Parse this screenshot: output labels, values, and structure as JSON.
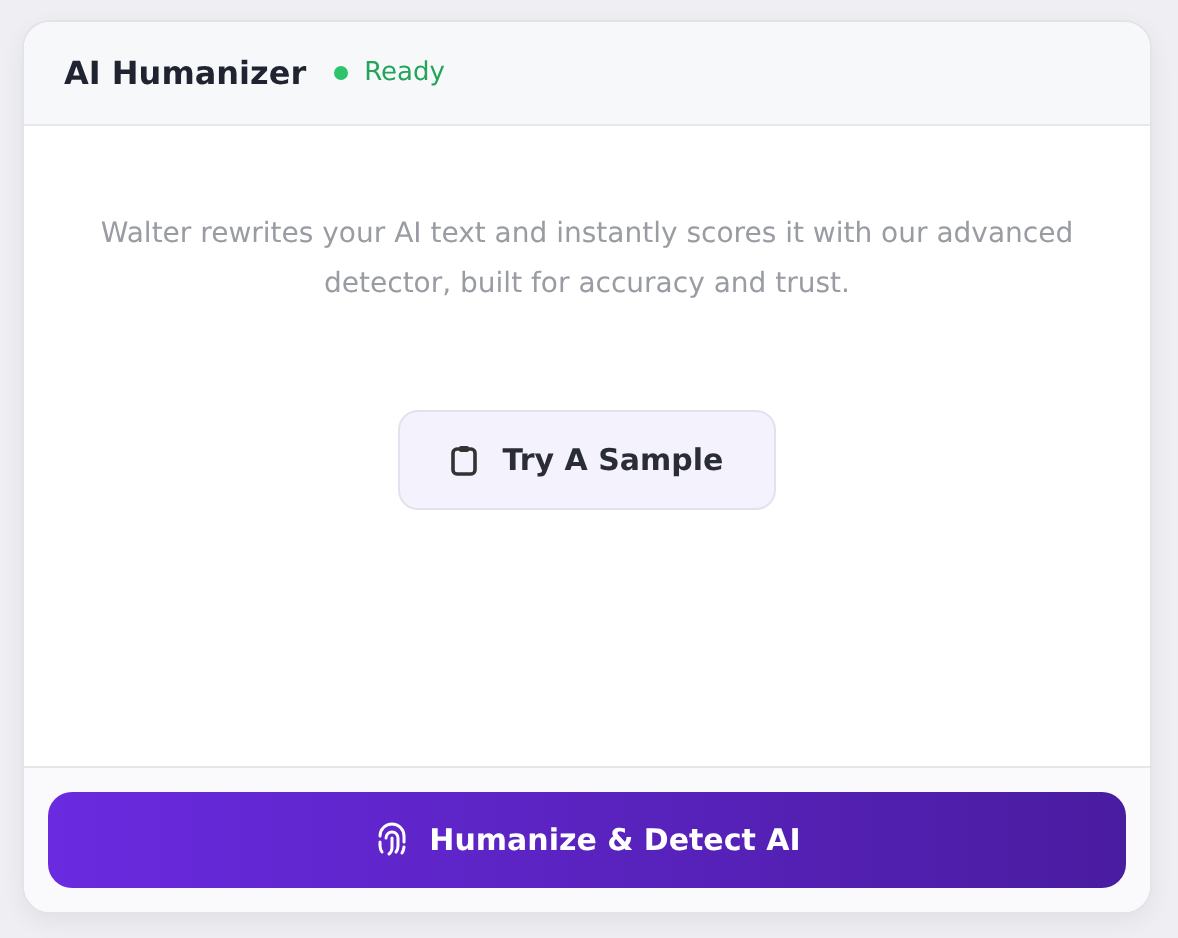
{
  "header": {
    "title": "AI Humanizer",
    "status": "Ready"
  },
  "description": "Walter rewrites your AI text and instantly scores it with our advanced detector, built for accuracy and trust.",
  "sample_button": "Try A Sample",
  "primary_button": "Humanize & Detect AI"
}
